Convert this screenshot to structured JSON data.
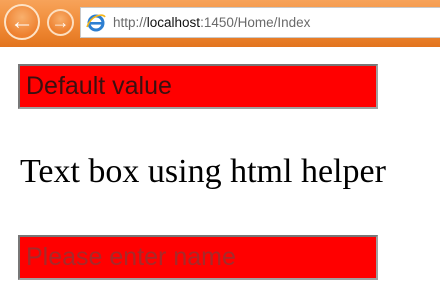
{
  "browser": {
    "address": {
      "prefix": "http://",
      "host": "localhost",
      "rest": ":1450/Home/Index"
    },
    "icons": {
      "back": "back-arrow-icon",
      "forward": "forward-arrow-icon",
      "page": "internet-explorer-icon"
    }
  },
  "page": {
    "first_input": {
      "value": "Default value"
    },
    "heading": "Text box using html helper",
    "second_input": {
      "placeholder": "Please enter name"
    }
  },
  "colors": {
    "input_background": "#ff0000",
    "toolbar": "#f08a36"
  }
}
